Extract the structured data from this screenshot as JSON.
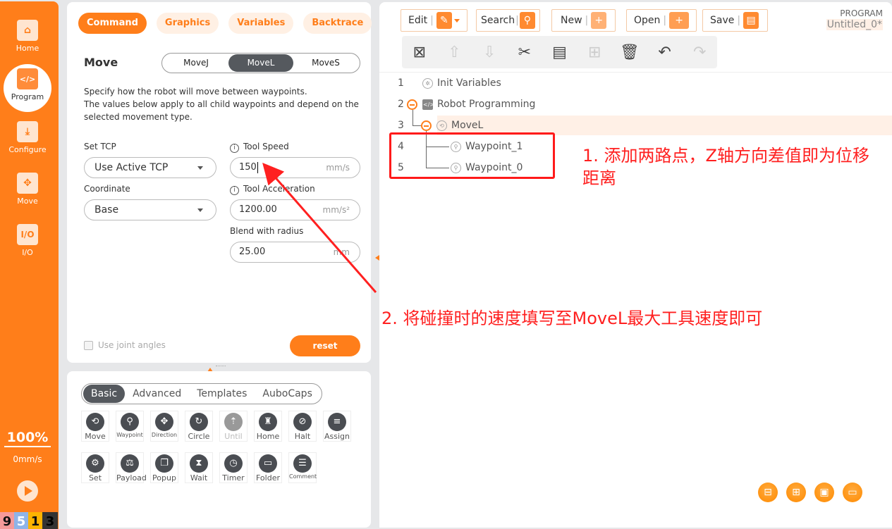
{
  "sidebar": {
    "items": [
      {
        "label": "Home",
        "icon": "home-icon",
        "glyph": "⌂"
      },
      {
        "label": "Program",
        "icon": "program-icon",
        "glyph": "</>"
      },
      {
        "label": "Configure",
        "icon": "configure-icon",
        "glyph": "⤓"
      },
      {
        "label": "Move",
        "icon": "move-icon",
        "glyph": "✥"
      },
      {
        "label": "I/O",
        "icon": "io-icon",
        "glyph": "I/O"
      }
    ],
    "speed_percent": "100%",
    "speed_value": "0mm/s",
    "badges": [
      {
        "text": "9",
        "color": "#f59a9a"
      },
      {
        "text": "5",
        "color": "#8fb4e8"
      },
      {
        "text": "1",
        "color": "#ffb300"
      },
      {
        "text": "3",
        "color": "#333333"
      }
    ]
  },
  "left_panel": {
    "tabs": [
      "Command",
      "Graphics",
      "Variables",
      "Backtrace"
    ],
    "active_tab": "Command",
    "title": "Move",
    "move_types": [
      "MoveJ",
      "MoveL",
      "MoveS"
    ],
    "active_move_type": "MoveL",
    "description": "Specify how the robot will move between waypoints.\n The values below apply to all child waypoints and depend on the selected movement type.",
    "set_tcp_label": "Set TCP",
    "set_tcp_value": "Use Active TCP",
    "coordinate_label": "Coordinate",
    "coordinate_value": "Base",
    "tool_speed_label": "Tool Speed",
    "tool_speed_value": "150",
    "tool_speed_unit": "mm/s",
    "tool_accel_label": "Tool Acceleration",
    "tool_accel_value": "1200.00",
    "tool_accel_unit": "mm/s²",
    "blend_label": "Blend with radius",
    "blend_value": "25.00",
    "blend_unit": "mm",
    "use_joint_angles_label": "Use joint angles",
    "use_joint_angles_checked": false,
    "reset_label": "reset"
  },
  "command_panel": {
    "tabs": [
      "Basic",
      "Advanced",
      "Templates",
      "AuboCaps"
    ],
    "active_tab": "Basic",
    "commands": [
      {
        "label": "Move",
        "glyph": "⟲",
        "small": false,
        "disabled": false
      },
      {
        "label": "Waypoint",
        "glyph": "⚲",
        "small": true,
        "disabled": false
      },
      {
        "label": "Direction",
        "glyph": "✥",
        "small": true,
        "disabled": false
      },
      {
        "label": "Circle",
        "glyph": "↻",
        "small": false,
        "disabled": false
      },
      {
        "label": "Until",
        "glyph": "⇡",
        "small": false,
        "disabled": true
      },
      {
        "label": "Home",
        "glyph": "♜",
        "small": false,
        "disabled": false
      },
      {
        "label": "Halt",
        "glyph": "⊘",
        "small": false,
        "disabled": false
      },
      {
        "label": "Assign",
        "glyph": "≡",
        "small": false,
        "disabled": false
      },
      {
        "label": "Set",
        "glyph": "⚙",
        "small": false,
        "disabled": false
      },
      {
        "label": "Payload",
        "glyph": "⚖",
        "small": false,
        "disabled": false
      },
      {
        "label": "Popup",
        "glyph": "❐",
        "small": false,
        "disabled": false
      },
      {
        "label": "Wait",
        "glyph": "⧗",
        "small": false,
        "disabled": false
      },
      {
        "label": "Timer",
        "glyph": "◷",
        "small": false,
        "disabled": false
      },
      {
        "label": "Folder",
        "glyph": "▭",
        "small": false,
        "disabled": false
      },
      {
        "label": "Comment",
        "glyph": "☰",
        "small": true,
        "disabled": false
      }
    ]
  },
  "program_panel": {
    "toolbar": [
      {
        "label": "Edit",
        "icon": "edit-icon",
        "glyph": "✎"
      },
      {
        "label": "Search",
        "icon": "search-icon",
        "glyph": "⚲"
      },
      {
        "label": "New",
        "icon": "new-icon",
        "glyph": "+"
      },
      {
        "label": "Open",
        "icon": "open-folder-icon",
        "glyph": "+"
      },
      {
        "label": "Save",
        "icon": "save-icon",
        "glyph": "▤"
      }
    ],
    "edit_actions": [
      {
        "name": "delete-node",
        "glyph": "⊠",
        "disabled": false
      },
      {
        "name": "move-up",
        "glyph": "⇧",
        "disabled": true
      },
      {
        "name": "move-down",
        "glyph": "⇩",
        "disabled": true
      },
      {
        "name": "cut",
        "glyph": "✂",
        "disabled": false
      },
      {
        "name": "copy",
        "glyph": "▤",
        "disabled": false
      },
      {
        "name": "paste",
        "glyph": "⊞",
        "disabled": true
      },
      {
        "name": "trash",
        "glyph": "🗑",
        "disabled": false
      },
      {
        "name": "undo",
        "glyph": "↶",
        "disabled": false
      },
      {
        "name": "redo",
        "glyph": "↷",
        "disabled": true
      }
    ],
    "program_label": "PROGRAM",
    "program_name": "Untitled_0*",
    "tree": [
      {
        "num": "1",
        "label": "Init Variables"
      },
      {
        "num": "2",
        "label": "Robot Programming"
      },
      {
        "num": "3",
        "label": "MoveL"
      },
      {
        "num": "4",
        "label": "Waypoint_1"
      },
      {
        "num": "5",
        "label": "Waypoint_0"
      }
    ],
    "selected_row": "3",
    "fab_buttons": [
      "collapse-tree",
      "expand-tree",
      "fullscreen",
      "console"
    ]
  },
  "annotations": {
    "note1": "1. 添加两路点，Z轴方向差值即为位移距离",
    "note2": "2. 将碰撞时的速度填写至MoveL最大工具速度即可",
    "color": "#ff2020"
  }
}
